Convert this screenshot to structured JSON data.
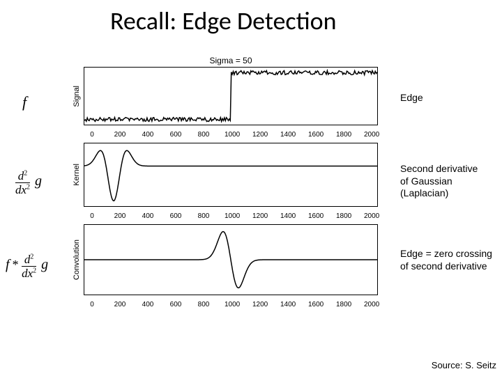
{
  "title": "Recall: Edge Detection",
  "sigma_title": "Sigma = 50",
  "ylabels": {
    "signal": "Signal",
    "kernel": "Kernel",
    "conv": "Convolution"
  },
  "left_labels": {
    "f": "f",
    "d2_num": "d",
    "d2_sup": "2",
    "d2_den_d": "d",
    "d2_den_x": "x",
    "g": "g",
    "fstar": "f",
    "star": " * "
  },
  "right_labels": {
    "r1": "Edge",
    "r2a": "Second derivative",
    "r2b": "of Gaussian",
    "r2c": "(Laplacian)",
    "r3a": "Edge = zero crossing",
    "r3b": "of second derivative"
  },
  "source": "Source: S. Seitz",
  "chart_data": [
    {
      "type": "line",
      "title": "Sigma = 50",
      "ylabel": "Signal",
      "xlabel": "",
      "xlim": [
        0,
        2000
      ],
      "xticks": [
        0,
        200,
        400,
        600,
        800,
        1000,
        1200,
        1400,
        1600,
        1800,
        2000
      ],
      "description": "Noisy step edge: low value (~0) for x<1000, high value (~1) for x>1000",
      "series": [
        {
          "name": "f",
          "x": [
            0,
            1000,
            1000,
            2000
          ],
          "y": [
            0.05,
            0.05,
            0.95,
            0.95
          ],
          "noise_amplitude": 0.04
        }
      ]
    },
    {
      "type": "line",
      "ylabel": "Kernel",
      "xlabel": "",
      "xlim": [
        0,
        2000
      ],
      "xticks": [
        0,
        200,
        400,
        600,
        800,
        1000,
        1200,
        1400,
        1600,
        1800,
        2000
      ],
      "description": "Second derivative of Gaussian (Laplacian of Gaussian / Mexican-hat) centered near x≈200, sigma=50",
      "series": [
        {
          "name": "d2g/dx2",
          "x": [
            0,
            80,
            120,
            160,
            200,
            240,
            280,
            320,
            400,
            2000
          ],
          "y": [
            0,
            0.15,
            0.45,
            0,
            -1.0,
            0,
            0.45,
            0.15,
            0,
            0
          ]
        }
      ]
    },
    {
      "type": "line",
      "ylabel": "Convolution",
      "xlabel": "",
      "xlim": [
        0,
        2000
      ],
      "xticks": [
        0,
        200,
        400,
        600,
        800,
        1000,
        1200,
        1400,
        1600,
        1800,
        2000
      ],
      "description": "Response of LoG to step edge: positive peak just before x≈1000, negative peak just after, zero crossing at x≈1000",
      "series": [
        {
          "name": "f*d2g/dx2",
          "x": [
            0,
            800,
            900,
            950,
            1000,
            1050,
            1100,
            1200,
            2000
          ],
          "y": [
            0,
            0,
            0.1,
            0.9,
            0,
            -1.0,
            -0.2,
            0,
            0
          ]
        }
      ]
    }
  ],
  "xticks_str": [
    "0",
    "200",
    "400",
    "600",
    "800",
    "1000",
    "1200",
    "1400",
    "1600",
    "1800",
    "2000"
  ]
}
